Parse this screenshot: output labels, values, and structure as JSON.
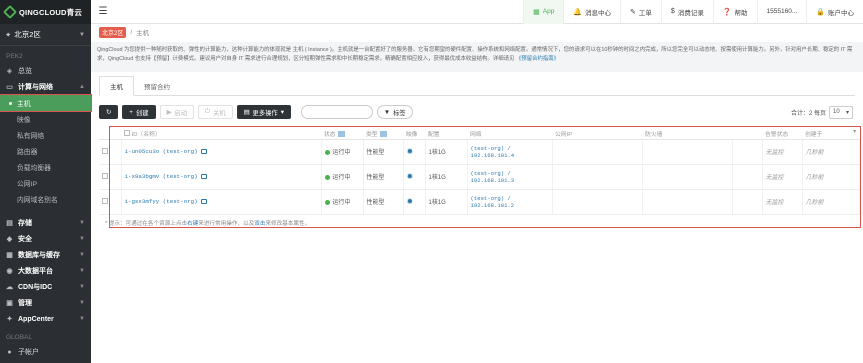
{
  "brand": {
    "logo_text": "QINGCLOUD青云"
  },
  "sidebar": {
    "region": "北京2区",
    "section_peking": "PEK2",
    "overview": "总览",
    "compute_group": "计算与网络",
    "compute_items": [
      "主机",
      "映像",
      "私有网络",
      "路由器",
      "负载均衡器",
      "公网IP",
      "内网域名别名"
    ],
    "groups": [
      "存储",
      "安全",
      "数据库与缓存",
      "大数据平台",
      "CDN与IDC",
      "管理",
      "AppCenter"
    ],
    "section_global": "GLOBAL",
    "global_item": "子帐户"
  },
  "topbar": {
    "app": "App",
    "messages": "消息中心",
    "tickets": "工单",
    "billing": "消费记录",
    "help": "帮助",
    "phone": "1555160...",
    "account": "账户中心"
  },
  "breadcrumb": {
    "zone": "北京2区",
    "page": "主机"
  },
  "description": {
    "text": "QingCloud 为您提供一种随时获取的、弹性的计算能力，这种计算能力的体现就是 主机 ( Instance )。主机就是一台配置好了的服务器，它有您期望的硬件配置、操作系统和网络配置。通常情况下，您的请求可以在10秒钟的时间之内完成，所以您完全可以动态地、按需使用计算能力。另外，针对用户长期、稳定的 IT 需求，QingCloud 也支持【预留】计费模式。建议用户对自身 IT 需求进行合理规划，区分短期弹性需求和中长期稳定需求，精确配置相应投入，获得最优成本收益结构。详细请见",
    "link": "《预留合约指南》"
  },
  "tabs": [
    "主机",
    "预留合约"
  ],
  "toolbar": {
    "create": "创建",
    "start": "启动",
    "stop": "关机",
    "more": "更多操作",
    "search_placeholder": "",
    "tag": "标签",
    "total": "合计：2 每页",
    "page_size": "10"
  },
  "table": {
    "headers": [
      "ID（名称）",
      "状态",
      "类型",
      "映像",
      "配置",
      "网络",
      "公网IP",
      "防火墙",
      "告警状态",
      "创建于"
    ],
    "rows": [
      {
        "id": "i-un05cu3o (test-org)",
        "status": "运行中",
        "type": "性能型",
        "config": "1核1G",
        "net1": "(test-org) /",
        "net2": "192.168.101.4",
        "public_ip": "",
        "firewall": "",
        "alarm": "无监控",
        "created": "几秒前"
      },
      {
        "id": "i-x9a3bgmv (test-org)",
        "status": "运行中",
        "type": "性能型",
        "config": "1核1G",
        "net1": "(test-org) /",
        "net2": "192.168.101.3",
        "public_ip": "",
        "firewall": "",
        "alarm": "无监控",
        "created": "几秒前"
      },
      {
        "id": "i-gsx3mfyy (test-org)",
        "status": "运行中",
        "type": "性能型",
        "config": "1核1G",
        "net1": "(test-org) /",
        "net2": "192.168.101.2",
        "public_ip": "",
        "firewall": "",
        "alarm": "无监控",
        "created": "几秒前"
      }
    ]
  },
  "hint": {
    "prefix": "* 提示：可通过在各个资源上点击",
    "link1": "右键",
    "middle": "来进行常用操作，以及",
    "link2": "双击",
    "suffix": "来修改基本属性。"
  },
  "colors": {
    "accent_green": "#4caf50",
    "sidebar_bg": "#2b2f33",
    "link": "#2a7ab0",
    "highlight_red": "#d9534f"
  }
}
